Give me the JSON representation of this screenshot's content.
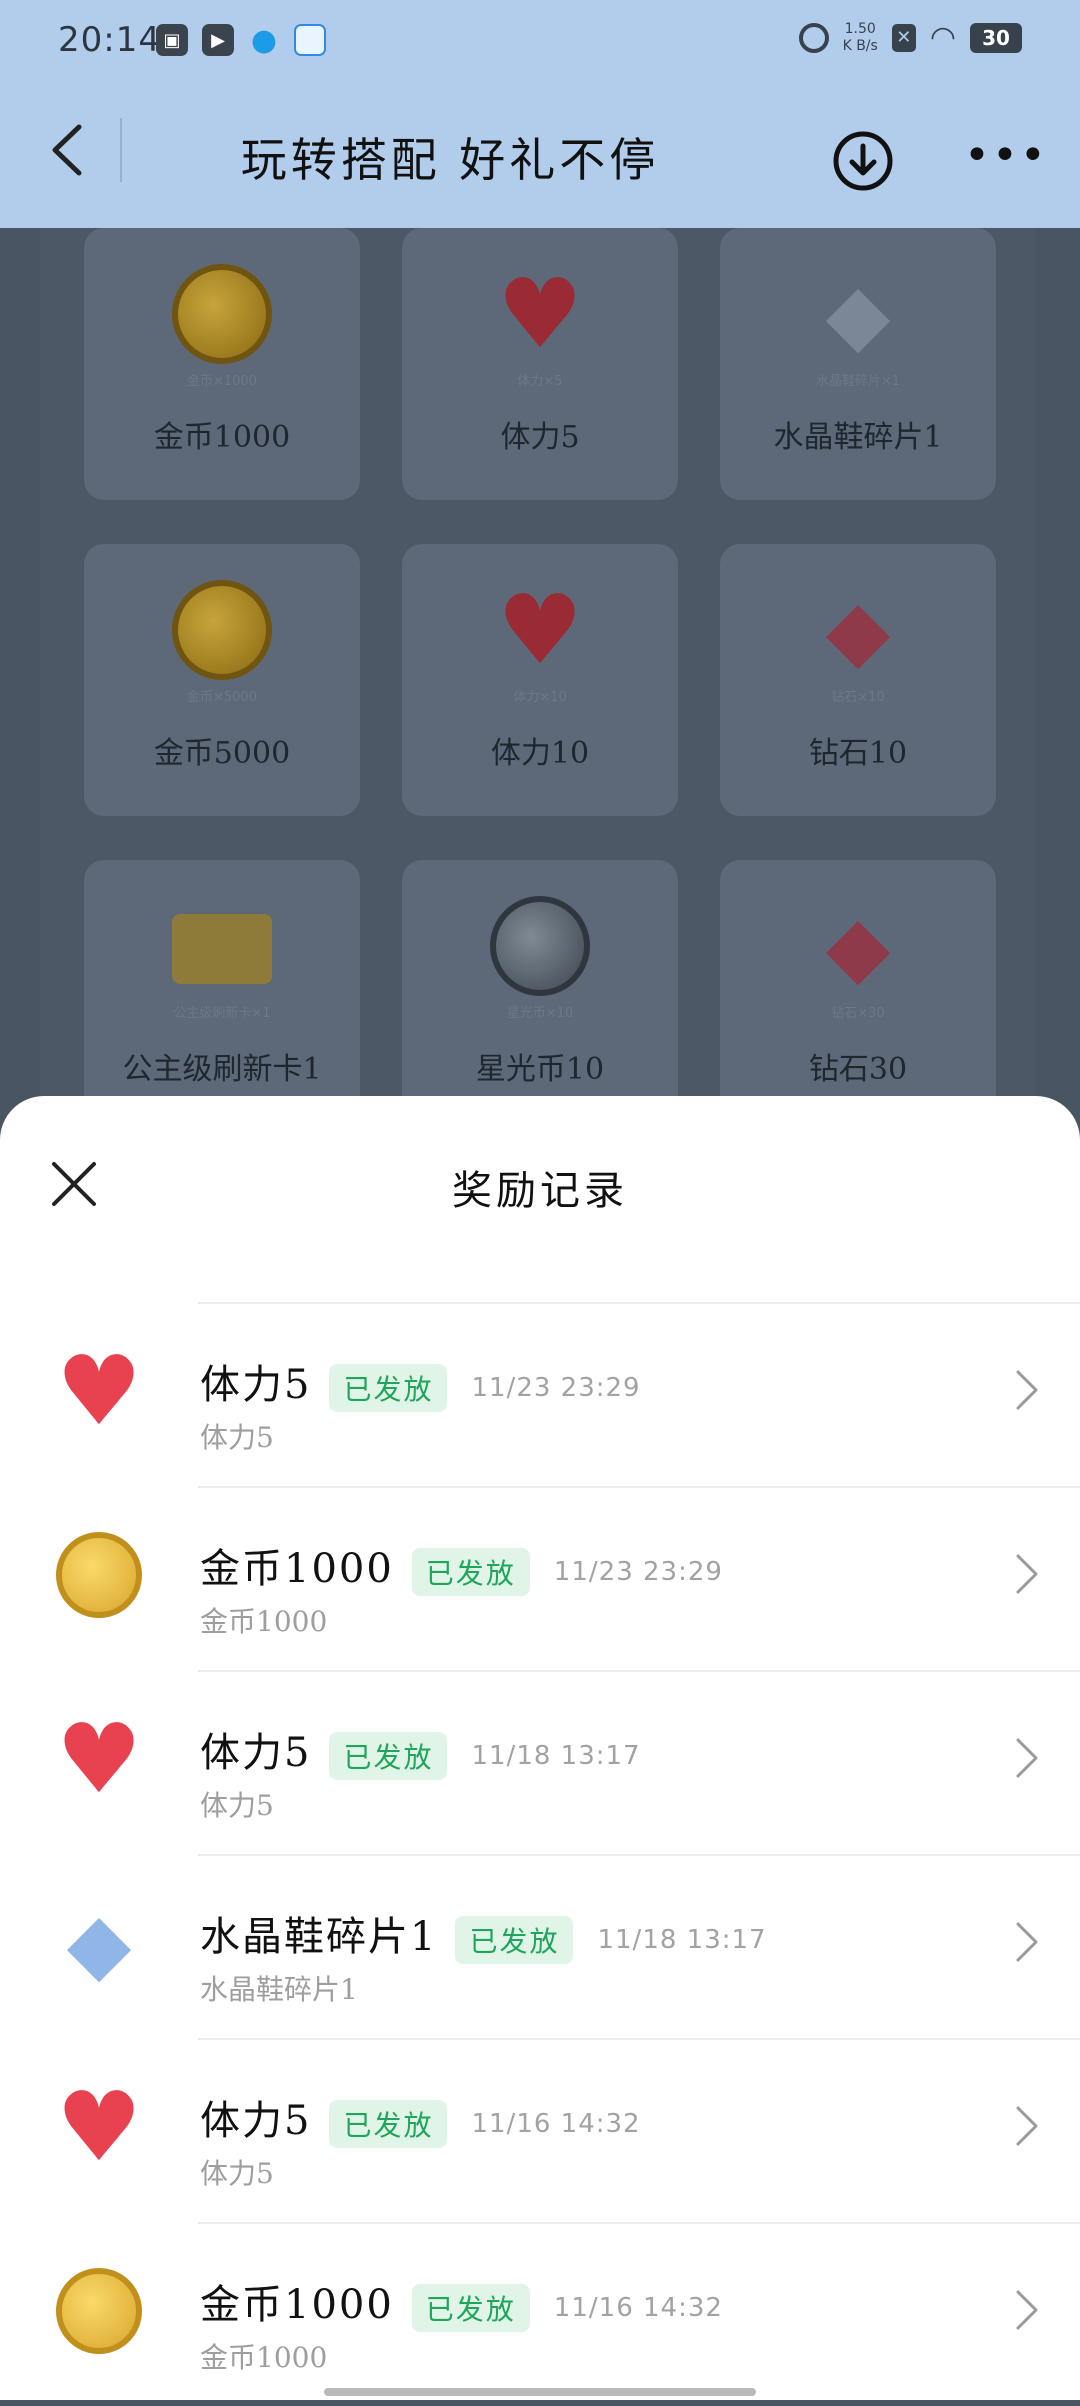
{
  "status_bar": {
    "time": "20:14",
    "net_speed": "1.50",
    "net_unit": "K B/s",
    "battery": "30"
  },
  "header": {
    "title": "玩转搭配 好礼不停"
  },
  "grid": [
    {
      "label": "金币1000",
      "sub": "金币×1000",
      "art": "coin"
    },
    {
      "label": "体力5",
      "sub": "体力×5",
      "art": "heart"
    },
    {
      "label": "水晶鞋碎片1",
      "sub": "水晶鞋碎片×1",
      "art": "crystal"
    },
    {
      "label": "金币5000",
      "sub": "金币×5000",
      "art": "coin"
    },
    {
      "label": "体力10",
      "sub": "体力×10",
      "art": "heart"
    },
    {
      "label": "钻石10",
      "sub": "钻石×10",
      "art": "gem"
    },
    {
      "label": "公主级刷新卡1",
      "sub": "公主级刷新卡×1",
      "art": "ticket"
    },
    {
      "label": "星光币10",
      "sub": "星光币×10",
      "art": "star-coin"
    },
    {
      "label": "钻石30",
      "sub": "钻石×30",
      "art": "gem"
    }
  ],
  "sheet": {
    "title": "奖励记录",
    "records": [
      {
        "name": "体力5",
        "status": "已发放",
        "time": "11/23 23:29",
        "desc": "体力5",
        "icon": "heart-icon"
      },
      {
        "name": "金币1000",
        "status": "已发放",
        "time": "11/23 23:29",
        "desc": "金币1000",
        "icon": "coin-icon"
      },
      {
        "name": "体力5",
        "status": "已发放",
        "time": "11/18 13:17",
        "desc": "体力5",
        "icon": "heart-icon"
      },
      {
        "name": "水晶鞋碎片1",
        "status": "已发放",
        "time": "11/18 13:17",
        "desc": "水晶鞋碎片1",
        "icon": "crystal-shard-icon"
      },
      {
        "name": "体力5",
        "status": "已发放",
        "time": "11/16 14:32",
        "desc": "体力5",
        "icon": "heart-icon"
      },
      {
        "name": "金币1000",
        "status": "已发放",
        "time": "11/16 14:32",
        "desc": "金币1000",
        "icon": "coin-icon"
      }
    ]
  }
}
